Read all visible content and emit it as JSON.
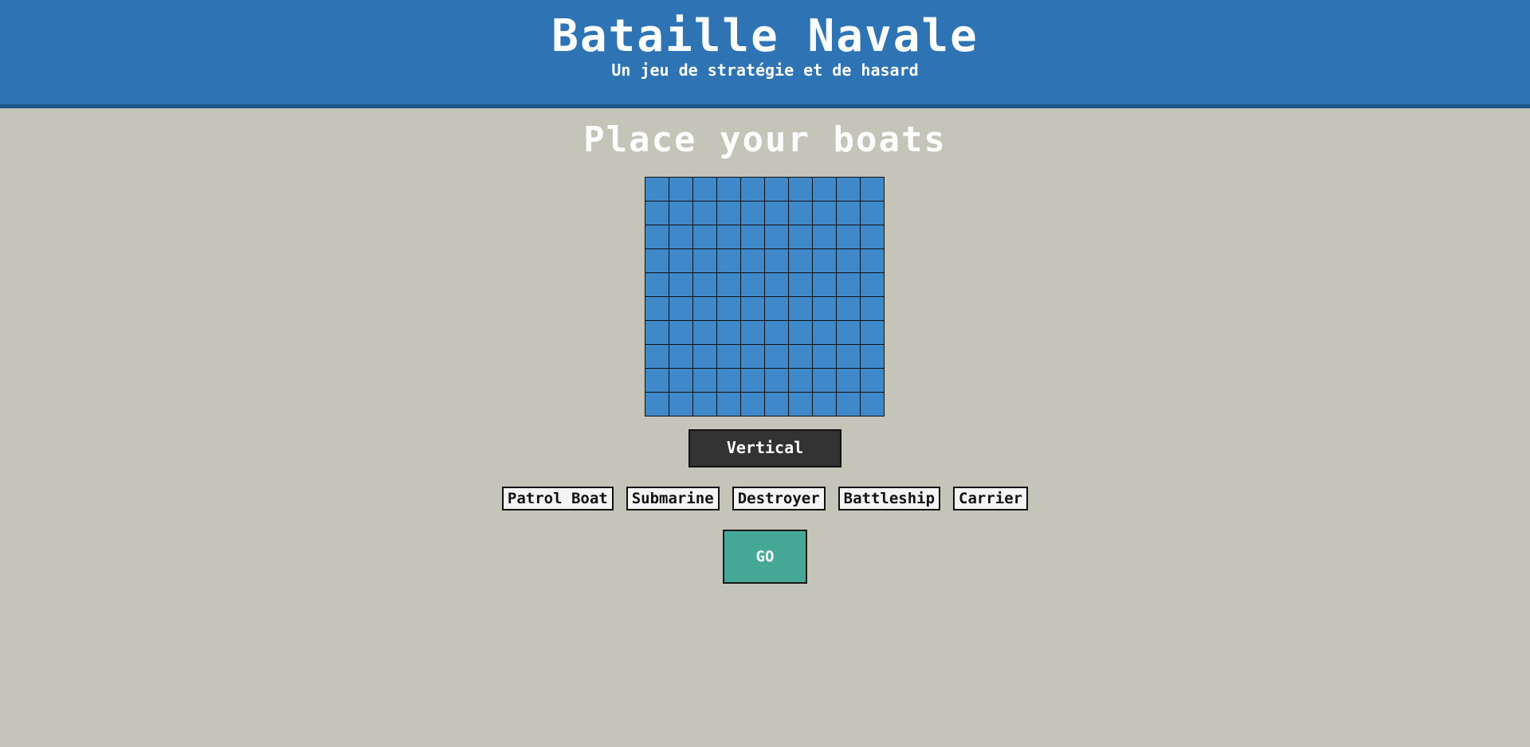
{
  "header": {
    "title": "Bataille Navale",
    "subtitle": "Un jeu de stratégie et de hasard"
  },
  "main": {
    "heading": "Place your boats",
    "board": {
      "rows": 10,
      "cols": 10,
      "cell_color": "#3f88c9"
    },
    "orientation_button": "Vertical",
    "boats": [
      "Patrol Boat",
      "Submarine",
      "Destroyer",
      "Battleship",
      "Carrier"
    ],
    "go_button": "GO"
  },
  "colors": {
    "header_bg": "#2e74b5",
    "page_bg": "#c4c4b8",
    "go_bg": "#45a897",
    "orient_bg": "#333333"
  }
}
